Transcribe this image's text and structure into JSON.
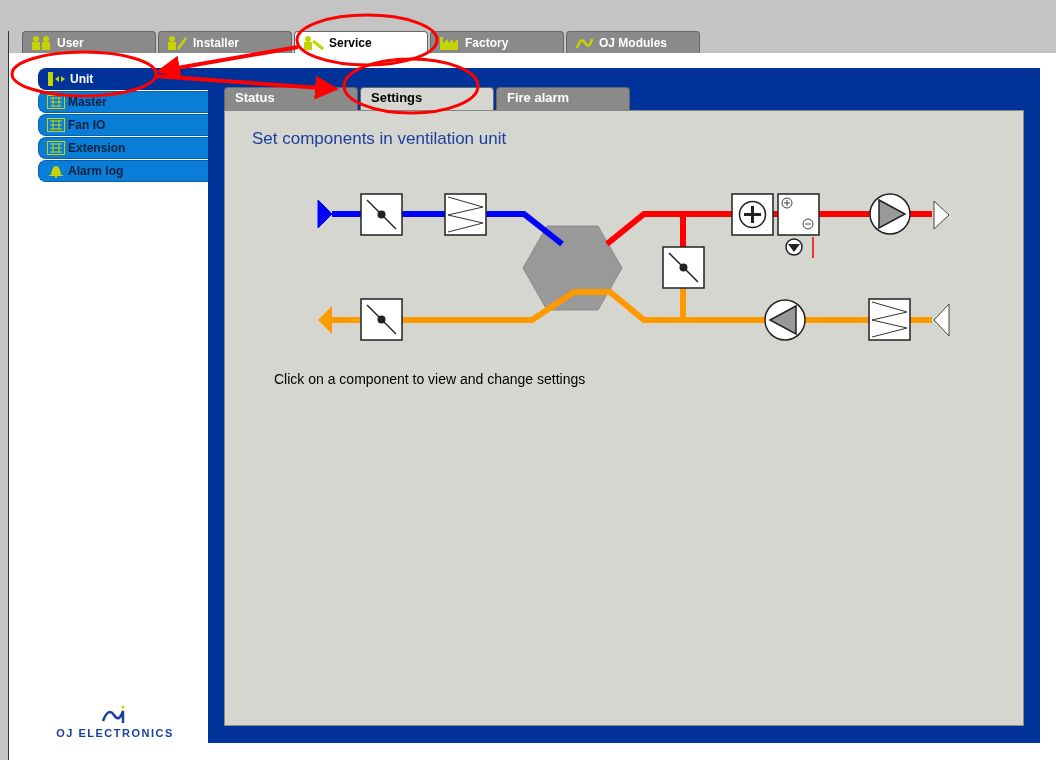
{
  "top_tabs": [
    {
      "label": "User",
      "kind": "user",
      "selected": false
    },
    {
      "label": "Installer",
      "kind": "installer",
      "selected": false
    },
    {
      "label": "Service",
      "kind": "service",
      "selected": true
    },
    {
      "label": "Factory",
      "kind": "factory",
      "selected": false
    },
    {
      "label": "OJ Modules",
      "kind": "modules",
      "selected": false
    }
  ],
  "sidebar": {
    "items": [
      {
        "label": "Unit",
        "kind": "unit",
        "selected": true
      },
      {
        "label": "Master",
        "kind": "module",
        "selected": false
      },
      {
        "label": "Fan IO",
        "kind": "module",
        "selected": false
      },
      {
        "label": "Extension",
        "kind": "module",
        "selected": false
      },
      {
        "label": "Alarm log",
        "kind": "alarm",
        "selected": false
      }
    ],
    "logo": "OJ ELECTRONICS"
  },
  "sub_tabs": [
    {
      "label": "Status",
      "selected": false
    },
    {
      "label": "Settings",
      "selected": true
    },
    {
      "label": "Fire alarm",
      "selected": false
    }
  ],
  "heading": "Set components in ventilation unit",
  "hint": "Click on a component to view and change settings"
}
